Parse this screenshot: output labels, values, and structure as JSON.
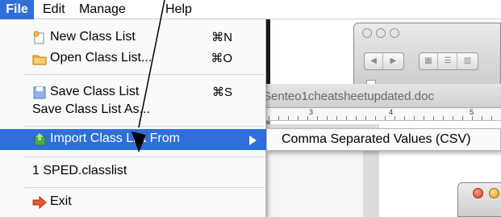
{
  "menubar": {
    "items": [
      {
        "label": "File"
      },
      {
        "label": "Edit"
      },
      {
        "label": "Manage"
      },
      {
        "label": "Help"
      }
    ]
  },
  "file_menu": {
    "items": [
      {
        "label": "New Class List",
        "shortcut": "⌘N",
        "icon": "new-document-icon"
      },
      {
        "label": "Open Class List...",
        "shortcut": "⌘O",
        "icon": "open-folder-icon"
      },
      {
        "label": "Save Class List",
        "shortcut": "⌘S",
        "icon": "save-icon"
      },
      {
        "label": "Save Class List As...",
        "shortcut": ""
      },
      {
        "label": "Import Class List From",
        "icon": "import-icon"
      },
      {
        "label": "1 SPED.classlist"
      },
      {
        "label": "Exit",
        "icon": "exit-arrow-icon"
      }
    ]
  },
  "submenu": {
    "items": [
      {
        "label": "Comma Separated Values (CSV)"
      }
    ]
  },
  "document": {
    "title": "Senteo1cheatsheetupdated.doc",
    "ruler_numbers": [
      "3",
      "4",
      "5"
    ]
  },
  "colors": {
    "highlight": "#2f6fd8",
    "menu_bg": "#fafafa"
  }
}
